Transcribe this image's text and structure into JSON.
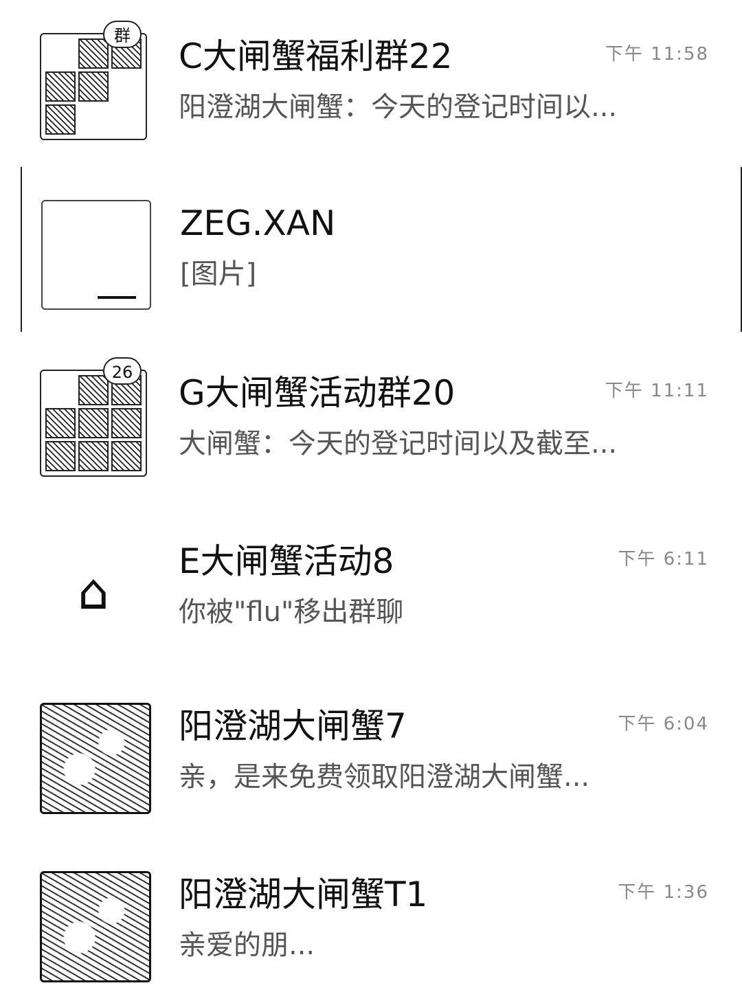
{
  "chats": [
    {
      "title": "C大闸蟹福利群22",
      "preview": "阳澄湖大闸蟹：今天的登记时间以...",
      "time": "下午 11:58",
      "avatar_type": "group-grid",
      "badge": "群"
    },
    {
      "title": "ZEG.XAN",
      "preview": "[图片]",
      "time": "",
      "avatar_type": "blank"
    },
    {
      "title": "G大闸蟹活动群20",
      "preview": "大闸蟹：今天的登记时间以及截至...",
      "time": "下午 11:11",
      "avatar_type": "group-grid",
      "badge": "26"
    },
    {
      "title": "E大闸蟹活动8",
      "preview": "你被\"flu\"移出群聊",
      "time": "下午 6:11",
      "avatar_type": "building-icon"
    },
    {
      "title": "阳澄湖大闸蟹7",
      "preview": "亲，是来免费领取阳澄湖大闸蟹...",
      "time": "下午 6:04",
      "avatar_type": "photo"
    },
    {
      "title": "阳澄湖大闸蟹T1",
      "preview": "亲爱的朋...",
      "time": "下午 1:36",
      "avatar_type": "photo"
    }
  ]
}
